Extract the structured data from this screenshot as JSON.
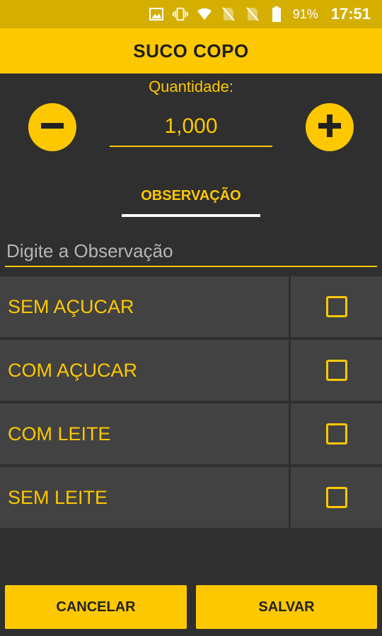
{
  "status_bar": {
    "battery_percent": "91%",
    "time": "17:51",
    "icons": [
      "image-icon",
      "vibrate-icon",
      "wifi-icon",
      "no-sim-icon",
      "no-sim-icon",
      "battery-icon"
    ]
  },
  "header": {
    "title": "SUCO COPO"
  },
  "quantity": {
    "label": "Quantidade:",
    "value": "1,000",
    "decrement_icon": "minus-icon",
    "increment_icon": "plus-icon"
  },
  "observation": {
    "tab_label": "OBSERVAÇÃO",
    "input_placeholder": "Digite a Observação",
    "input_value": ""
  },
  "options": [
    {
      "label": "SEM AÇUCAR",
      "checked": false
    },
    {
      "label": "COM AÇUCAR",
      "checked": false
    },
    {
      "label": "COM LEITE",
      "checked": false
    },
    {
      "label": "SEM LEITE",
      "checked": false
    }
  ],
  "actions": {
    "cancel_label": "CANCELAR",
    "save_label": "SALVAR"
  },
  "colors": {
    "accent": "#fdc800",
    "status_bar": "#d4ae00",
    "background": "#2f2f2f",
    "row": "#424242"
  }
}
